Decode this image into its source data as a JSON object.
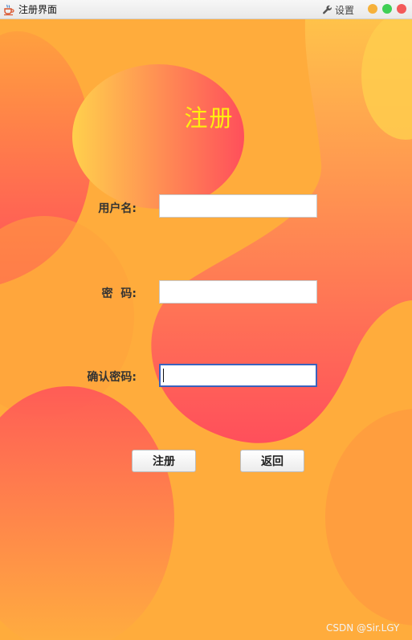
{
  "window": {
    "title": "注册界面",
    "settings_label": "设置",
    "app_icon": "java-coffee-cup-icon",
    "settings_icon": "wrench-icon",
    "controls": [
      "minimize",
      "maximize",
      "close"
    ]
  },
  "form": {
    "heading": "注册",
    "username_label": "用户名:",
    "password_label": "密  码:",
    "confirm_label": "确认密码:",
    "username_value": "",
    "password_value": "",
    "confirm_value": ""
  },
  "buttons": {
    "register": "注册",
    "back": "返回"
  },
  "watermark": "CSDN @Sir.LGY",
  "colors": {
    "background": "#ffac3c",
    "blob_gradient_from": "#ffd04c",
    "blob_gradient_to": "#ff4f5b",
    "heading": "#ffee10",
    "focus_border": "#3a63bd"
  }
}
